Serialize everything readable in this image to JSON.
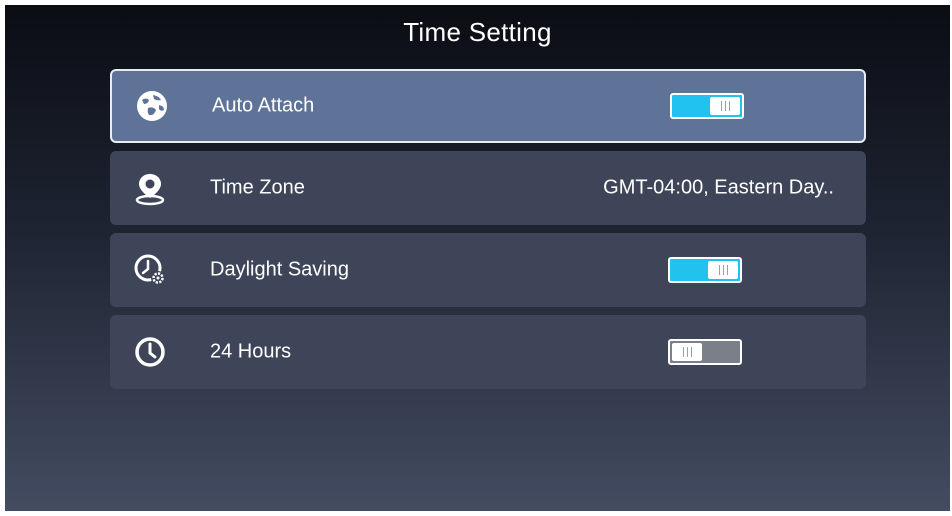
{
  "title": "Time Setting",
  "rows": [
    {
      "label": "Auto Attach",
      "icon": "globe-icon",
      "toggle": true,
      "selected": true
    },
    {
      "label": "Time Zone",
      "icon": "location-pin-icon",
      "value": "GMT-04:00, Eastern Day.."
    },
    {
      "label": "Daylight Saving",
      "icon": "clock-gear-icon",
      "toggle": true
    },
    {
      "label": "24 Hours",
      "icon": "clock-icon",
      "toggle": false
    }
  ],
  "colors": {
    "accent": "#21c3ee",
    "selected_row": "#5f7399",
    "row": "#3e4559"
  }
}
